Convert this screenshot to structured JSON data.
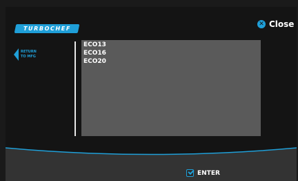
{
  "header": {
    "logo_text": "TURBOCHEF",
    "close_label": "Close",
    "close_icon": "x-circle-icon"
  },
  "sidebar": {
    "return_label": "RETURN TO MFG",
    "return_icon": "arrow-left-icon"
  },
  "list": {
    "items": [
      "ECO13",
      "ECO16",
      "ECO20"
    ]
  },
  "footer": {
    "enter_label": "ENTER",
    "enter_icon": "checkbox-check-icon"
  },
  "colors": {
    "accent": "#1f9fd8",
    "background": "#141414",
    "panel": "#5a5a5a",
    "footer": "#333333"
  }
}
